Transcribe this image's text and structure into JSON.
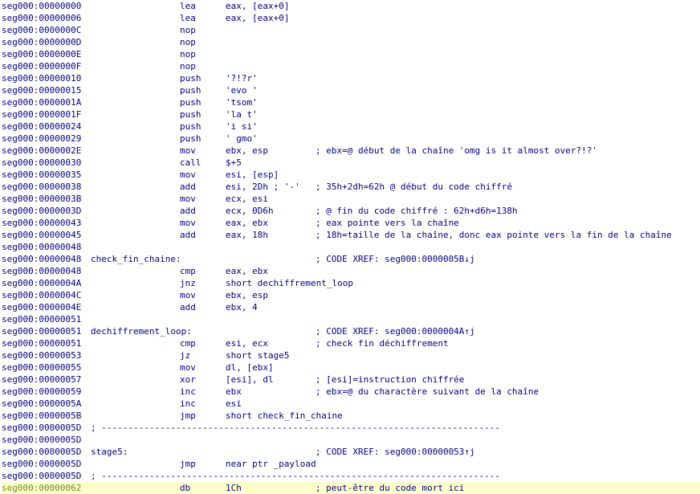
{
  "lines": [
    {
      "addr": "seg000:00000000",
      "mnemonic": "lea",
      "operand": "eax, [eax+0]"
    },
    {
      "addr": "seg000:00000006",
      "mnemonic": "lea",
      "operand": "eax, [eax+0]"
    },
    {
      "addr": "seg000:0000000C",
      "mnemonic": "nop"
    },
    {
      "addr": "seg000:0000000D",
      "mnemonic": "nop"
    },
    {
      "addr": "seg000:0000000E",
      "mnemonic": "nop"
    },
    {
      "addr": "seg000:0000000F",
      "mnemonic": "nop"
    },
    {
      "addr": "seg000:00000010",
      "mnemonic": "push",
      "operand": "'?!?r'"
    },
    {
      "addr": "seg000:00000015",
      "mnemonic": "push",
      "operand": "'evo '"
    },
    {
      "addr": "seg000:0000001A",
      "mnemonic": "push",
      "operand": "'tsom'"
    },
    {
      "addr": "seg000:0000001F",
      "mnemonic": "push",
      "operand": "'la t'"
    },
    {
      "addr": "seg000:00000024",
      "mnemonic": "push",
      "operand": "'i si'"
    },
    {
      "addr": "seg000:00000029",
      "mnemonic": "push",
      "operand": "' gmo'"
    },
    {
      "addr": "seg000:0000002E",
      "mnemonic": "mov",
      "operand": "ebx, esp",
      "comment": "; ebx=@ début de la chaîne 'omg is it almost over?!?'"
    },
    {
      "addr": "seg000:00000030",
      "mnemonic": "call",
      "operand": "$+5"
    },
    {
      "addr": "seg000:00000035",
      "mnemonic": "mov",
      "operand": "esi, [esp]"
    },
    {
      "addr": "seg000:00000038",
      "mnemonic": "add",
      "operand": "esi, 2Dh ; '-'",
      "comment": "; 35h+2dh=62h @ début du code chiffré"
    },
    {
      "addr": "seg000:0000003B",
      "mnemonic": "mov",
      "operand": "ecx, esi"
    },
    {
      "addr": "seg000:0000003D",
      "mnemonic": "add",
      "operand": "ecx, 0D6h",
      "comment": "; @ fin du code chiffré : 62h+d6h=138h"
    },
    {
      "addr": "seg000:00000043",
      "mnemonic": "mov",
      "operand": "eax, ebx",
      "comment": "; eax pointe vers la chaîne"
    },
    {
      "addr": "seg000:00000045",
      "mnemonic": "add",
      "operand": "eax, 18h",
      "comment": "; 18h=taille de la chaîne, donc eax pointe vers la fin de la chaîne"
    },
    {
      "addr": "seg000:00000048"
    },
    {
      "addr": "seg000:00000048",
      "label": "check_fin_chaine:",
      "comment": "; CODE XREF: seg000:0000005B↓j"
    },
    {
      "addr": "seg000:00000048",
      "mnemonic": "cmp",
      "operand": "eax, ebx"
    },
    {
      "addr": "seg000:0000004A",
      "mnemonic": "jnz",
      "operand": "short dechiffrement_loop"
    },
    {
      "addr": "seg000:0000004C",
      "mnemonic": "mov",
      "operand": "ebx, esp"
    },
    {
      "addr": "seg000:0000004E",
      "mnemonic": "add",
      "operand": "ebx, 4"
    },
    {
      "addr": "seg000:00000051"
    },
    {
      "addr": "seg000:00000051",
      "label": "dechiffrement_loop:",
      "comment": "; CODE XREF: seg000:0000004A↑j"
    },
    {
      "addr": "seg000:00000051",
      "mnemonic": "cmp",
      "operand": "esi, ecx",
      "comment": "; check fin déchiffrement"
    },
    {
      "addr": "seg000:00000053",
      "mnemonic": "jz",
      "operand": "short stage5"
    },
    {
      "addr": "seg000:00000055",
      "mnemonic": "mov",
      "operand": "dl, [ebx]"
    },
    {
      "addr": "seg000:00000057",
      "mnemonic": "xor",
      "operand": "[esi], dl",
      "comment": "; [esi]=instruction chiffrée"
    },
    {
      "addr": "seg000:00000059",
      "mnemonic": "inc",
      "operand": "ebx",
      "comment": "; ebx=@ du charactère suivant de la chaîne"
    },
    {
      "addr": "seg000:0000005A",
      "mnemonic": "inc",
      "operand": "esi"
    },
    {
      "addr": "seg000:0000005B",
      "mnemonic": "jmp",
      "operand": "short check_fin_chaine"
    },
    {
      "addr": "seg000:0000005D",
      "separator": "; ---------------------------------------------------------------------------"
    },
    {
      "addr": "seg000:0000005D"
    },
    {
      "addr": "seg000:0000005D",
      "label": "stage5:",
      "comment": "; CODE XREF: seg000:00000053↑j"
    },
    {
      "addr": "seg000:0000005D",
      "mnemonic": "jmp",
      "operand": "near ptr _payload"
    },
    {
      "addr": "seg000:0000005D",
      "separator": "; ---------------------------------------------------------------------------"
    },
    {
      "addr": "seg000:00000062",
      "mnemonic": "db",
      "operand": "1Ch",
      "comment": "; peut-être du code mort ici",
      "highlight": true
    }
  ],
  "colors": {
    "text": "#000080",
    "address_highlight": "#6b8e23",
    "highlight_background": "#ffffcc",
    "numbers": "#008000"
  }
}
